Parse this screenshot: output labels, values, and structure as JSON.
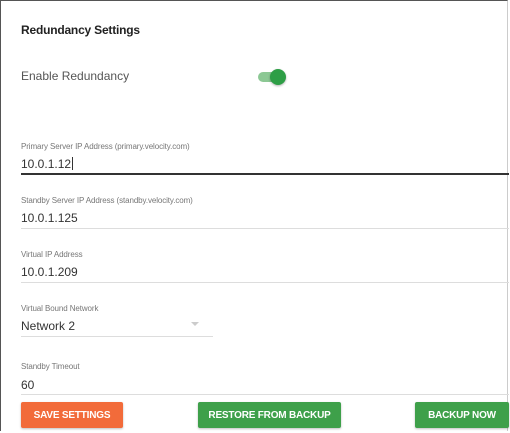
{
  "panel": {
    "title": "Redundancy Settings"
  },
  "redundancy": {
    "label": "Enable Redundancy",
    "enabled": true
  },
  "fields": {
    "primary": {
      "label": "Primary Server IP Address (primary.velocity.com)",
      "value": "10.0.1.12"
    },
    "standby": {
      "label": "Standby Server IP Address (standby.velocity.com)",
      "value": "10.0.1.125"
    },
    "virtual_ip": {
      "label": "Virtual IP Address",
      "value": "10.0.1.209"
    },
    "bound_network": {
      "label": "Virtual Bound Network",
      "value": "Network 2"
    },
    "timeout": {
      "label": "Standby Timeout",
      "value": "60"
    }
  },
  "buttons": {
    "save": "SAVE SETTINGS",
    "restore": "RESTORE FROM BACKUP",
    "backup": "BACKUP NOW"
  },
  "colors": {
    "toggle_on": "#2e9e46",
    "save_button": "#f26b3a",
    "action_button": "#3ea04a"
  },
  "icons": {
    "dropdown": "chevron-down-icon"
  }
}
